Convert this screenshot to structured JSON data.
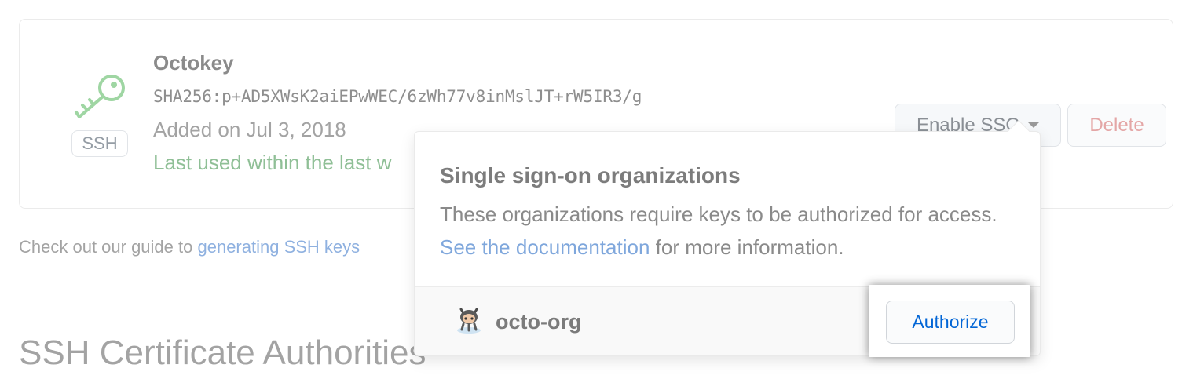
{
  "ssh_key": {
    "title": "Octokey",
    "fingerprint": "SHA256:p+AD5XWsK2aiEPwWEC/6zWh77v8inMslJT+rW5IR3/g",
    "added": "Added on Jul 3, 2018",
    "last_used": "Last used within the last w",
    "badge": "SSH",
    "icon": "key-icon",
    "enable_sso_label": "Enable SSO",
    "delete_label": "Delete"
  },
  "guide": {
    "prefix": "Check out our guide to ",
    "link": "generating SSH keys"
  },
  "section_heading": "SSH Certificate Authorities",
  "popover": {
    "title": "Single sign-on organizations",
    "description_prefix": "These organizations require keys to be authorized for access. ",
    "description_link": "See the documentation",
    "description_suffix": " for more information.",
    "org": {
      "name": "octo-org",
      "avatar_icon": "octocat-icon",
      "authorize_label": "Authorize"
    }
  },
  "colors": {
    "link": "#0366d6",
    "last_used_green": "#8fbf96",
    "delete_red": "#e4a6a6"
  }
}
